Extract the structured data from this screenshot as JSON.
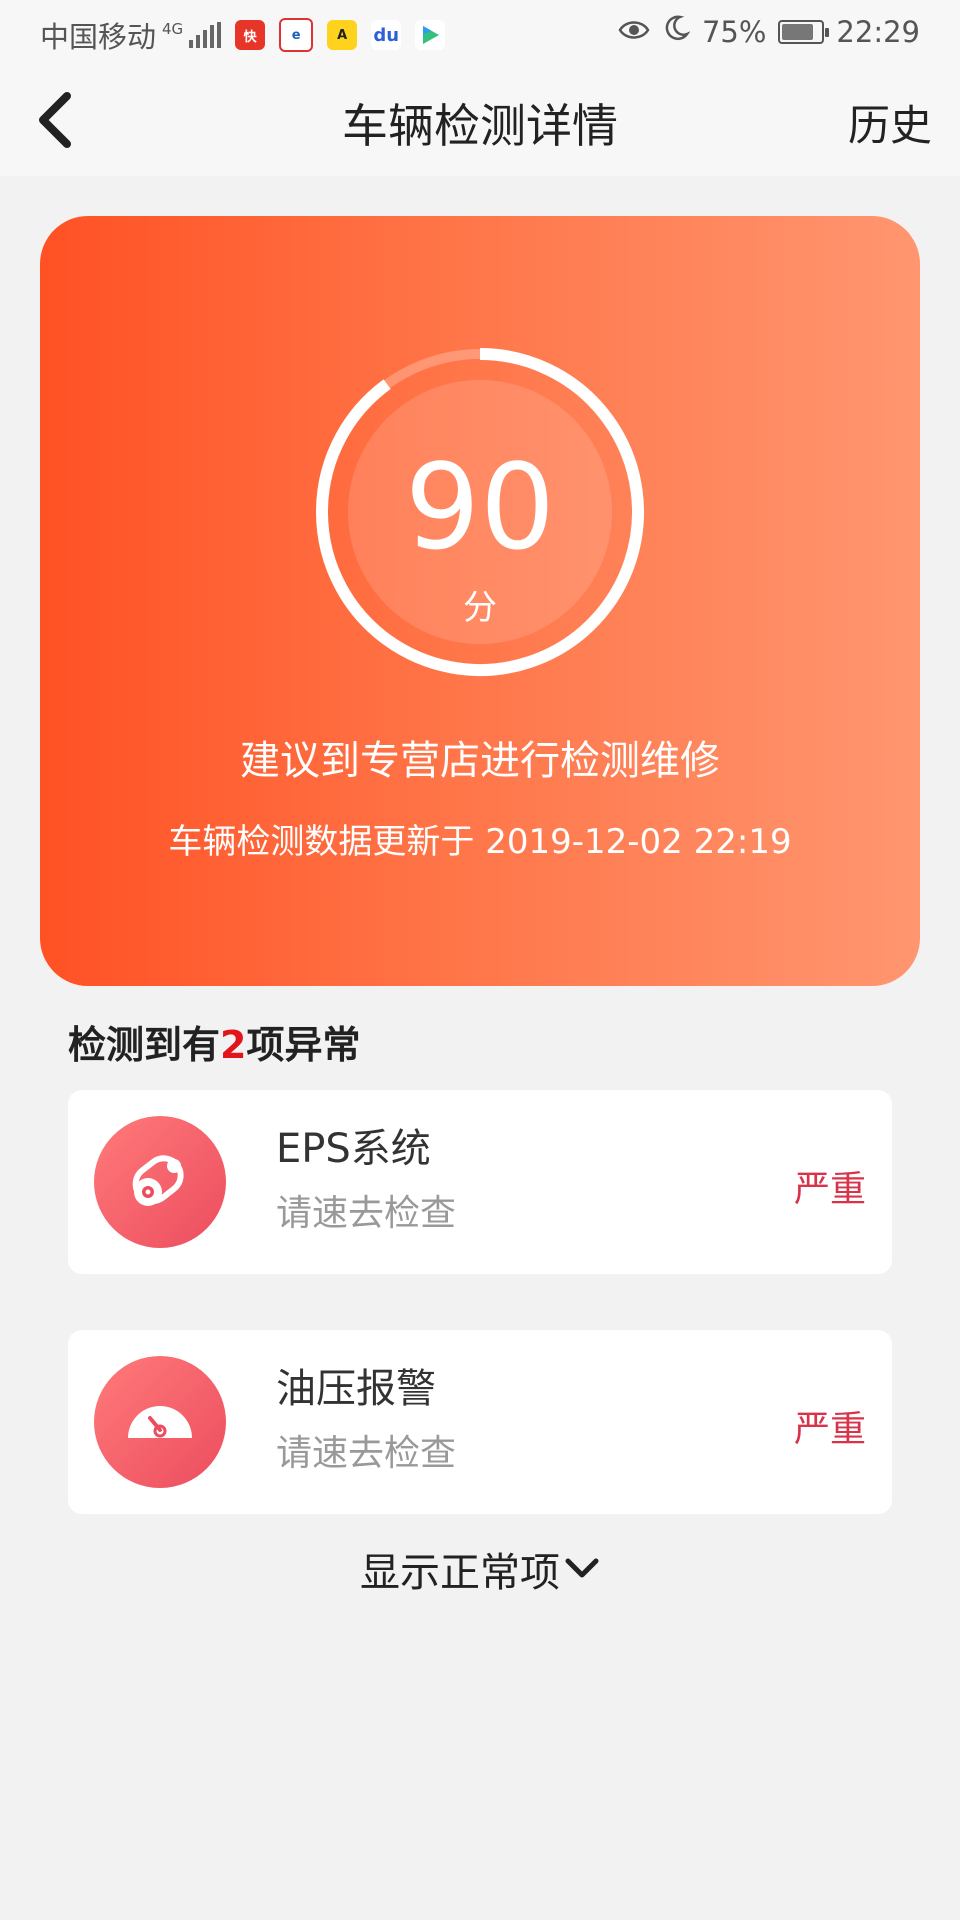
{
  "status_bar": {
    "carrier": "中国移动",
    "network": "4G",
    "battery": "75%",
    "time": "22:29"
  },
  "nav": {
    "title": "车辆检测详情",
    "history_label": "历史"
  },
  "score": {
    "value": "90",
    "unit": "分",
    "ring_progress": 0.9,
    "advice": "建议到专营店进行检测维修",
    "update_time": "车辆检测数据更新于 2019-12-02 22:19"
  },
  "abnormal": {
    "prefix": "检测到有",
    "count": "2",
    "suffix": "项异常"
  },
  "items": [
    {
      "name": "EPS系统",
      "sub": "请速去检查",
      "level": "严重",
      "icon": "steering-belt-icon"
    },
    {
      "name": "油压报警",
      "sub": "请速去检查",
      "level": "严重",
      "icon": "gauge-icon"
    }
  ],
  "show_normal_label": "显示正常项",
  "colors": {
    "card_gradient_start": "#ff5124",
    "card_gradient_end": "#ff9670",
    "alert_red": "#e2151c",
    "level_red": "#d8334a"
  }
}
